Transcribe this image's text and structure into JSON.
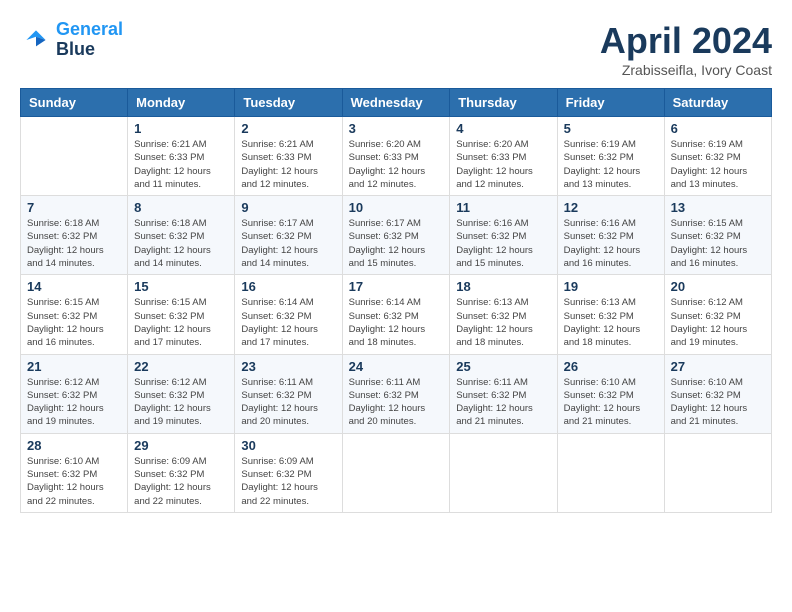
{
  "header": {
    "logo_line1": "General",
    "logo_line2": "Blue",
    "month_title": "April 2024",
    "location": "Zrabisseifla, Ivory Coast"
  },
  "weekdays": [
    "Sunday",
    "Monday",
    "Tuesday",
    "Wednesday",
    "Thursday",
    "Friday",
    "Saturday"
  ],
  "weeks": [
    [
      {
        "day": "",
        "info": ""
      },
      {
        "day": "1",
        "info": "Sunrise: 6:21 AM\nSunset: 6:33 PM\nDaylight: 12 hours\nand 11 minutes."
      },
      {
        "day": "2",
        "info": "Sunrise: 6:21 AM\nSunset: 6:33 PM\nDaylight: 12 hours\nand 12 minutes."
      },
      {
        "day": "3",
        "info": "Sunrise: 6:20 AM\nSunset: 6:33 PM\nDaylight: 12 hours\nand 12 minutes."
      },
      {
        "day": "4",
        "info": "Sunrise: 6:20 AM\nSunset: 6:33 PM\nDaylight: 12 hours\nand 12 minutes."
      },
      {
        "day": "5",
        "info": "Sunrise: 6:19 AM\nSunset: 6:32 PM\nDaylight: 12 hours\nand 13 minutes."
      },
      {
        "day": "6",
        "info": "Sunrise: 6:19 AM\nSunset: 6:32 PM\nDaylight: 12 hours\nand 13 minutes."
      }
    ],
    [
      {
        "day": "7",
        "info": "Sunrise: 6:18 AM\nSunset: 6:32 PM\nDaylight: 12 hours\nand 14 minutes."
      },
      {
        "day": "8",
        "info": "Sunrise: 6:18 AM\nSunset: 6:32 PM\nDaylight: 12 hours\nand 14 minutes."
      },
      {
        "day": "9",
        "info": "Sunrise: 6:17 AM\nSunset: 6:32 PM\nDaylight: 12 hours\nand 14 minutes."
      },
      {
        "day": "10",
        "info": "Sunrise: 6:17 AM\nSunset: 6:32 PM\nDaylight: 12 hours\nand 15 minutes."
      },
      {
        "day": "11",
        "info": "Sunrise: 6:16 AM\nSunset: 6:32 PM\nDaylight: 12 hours\nand 15 minutes."
      },
      {
        "day": "12",
        "info": "Sunrise: 6:16 AM\nSunset: 6:32 PM\nDaylight: 12 hours\nand 16 minutes."
      },
      {
        "day": "13",
        "info": "Sunrise: 6:15 AM\nSunset: 6:32 PM\nDaylight: 12 hours\nand 16 minutes."
      }
    ],
    [
      {
        "day": "14",
        "info": "Sunrise: 6:15 AM\nSunset: 6:32 PM\nDaylight: 12 hours\nand 16 minutes."
      },
      {
        "day": "15",
        "info": "Sunrise: 6:15 AM\nSunset: 6:32 PM\nDaylight: 12 hours\nand 17 minutes."
      },
      {
        "day": "16",
        "info": "Sunrise: 6:14 AM\nSunset: 6:32 PM\nDaylight: 12 hours\nand 17 minutes."
      },
      {
        "day": "17",
        "info": "Sunrise: 6:14 AM\nSunset: 6:32 PM\nDaylight: 12 hours\nand 18 minutes."
      },
      {
        "day": "18",
        "info": "Sunrise: 6:13 AM\nSunset: 6:32 PM\nDaylight: 12 hours\nand 18 minutes."
      },
      {
        "day": "19",
        "info": "Sunrise: 6:13 AM\nSunset: 6:32 PM\nDaylight: 12 hours\nand 18 minutes."
      },
      {
        "day": "20",
        "info": "Sunrise: 6:12 AM\nSunset: 6:32 PM\nDaylight: 12 hours\nand 19 minutes."
      }
    ],
    [
      {
        "day": "21",
        "info": "Sunrise: 6:12 AM\nSunset: 6:32 PM\nDaylight: 12 hours\nand 19 minutes."
      },
      {
        "day": "22",
        "info": "Sunrise: 6:12 AM\nSunset: 6:32 PM\nDaylight: 12 hours\nand 19 minutes."
      },
      {
        "day": "23",
        "info": "Sunrise: 6:11 AM\nSunset: 6:32 PM\nDaylight: 12 hours\nand 20 minutes."
      },
      {
        "day": "24",
        "info": "Sunrise: 6:11 AM\nSunset: 6:32 PM\nDaylight: 12 hours\nand 20 minutes."
      },
      {
        "day": "25",
        "info": "Sunrise: 6:11 AM\nSunset: 6:32 PM\nDaylight: 12 hours\nand 21 minutes."
      },
      {
        "day": "26",
        "info": "Sunrise: 6:10 AM\nSunset: 6:32 PM\nDaylight: 12 hours\nand 21 minutes."
      },
      {
        "day": "27",
        "info": "Sunrise: 6:10 AM\nSunset: 6:32 PM\nDaylight: 12 hours\nand 21 minutes."
      }
    ],
    [
      {
        "day": "28",
        "info": "Sunrise: 6:10 AM\nSunset: 6:32 PM\nDaylight: 12 hours\nand 22 minutes."
      },
      {
        "day": "29",
        "info": "Sunrise: 6:09 AM\nSunset: 6:32 PM\nDaylight: 12 hours\nand 22 minutes."
      },
      {
        "day": "30",
        "info": "Sunrise: 6:09 AM\nSunset: 6:32 PM\nDaylight: 12 hours\nand 22 minutes."
      },
      {
        "day": "",
        "info": ""
      },
      {
        "day": "",
        "info": ""
      },
      {
        "day": "",
        "info": ""
      },
      {
        "day": "",
        "info": ""
      }
    ]
  ]
}
